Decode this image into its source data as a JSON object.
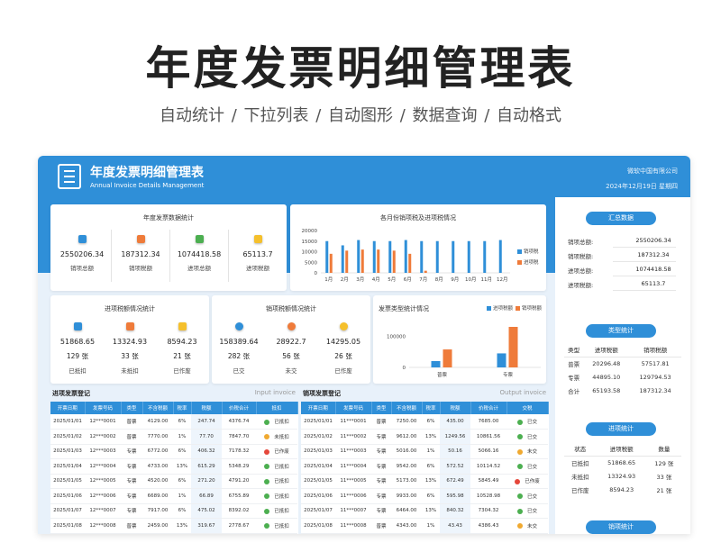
{
  "hero": {
    "title": "年度发票明细管理表",
    "subtitle": "自动统计  /  下拉列表  /  自动图形  /  数据查询  /  自动格式"
  },
  "banner": {
    "title": "年度发票明细管理表",
    "title_en": "Annual Invoice Details Management",
    "company": "微软中国有限公司",
    "date": "2024年12月19日    星期四",
    "icon": "document-checklist-icon"
  },
  "annual_stats": {
    "title": "年度发票数据统计",
    "items": [
      {
        "value": "2550206.34",
        "label": "销项总额",
        "color": "#2f8fd8"
      },
      {
        "value": "187312.34",
        "label": "销项税额",
        "color": "#ef7b3a"
      },
      {
        "value": "1074418.58",
        "label": "进项总额",
        "color": "#4caf50"
      },
      {
        "value": "65113.7",
        "label": "进项税额",
        "color": "#f5c02c"
      }
    ]
  },
  "monthly_chart": {
    "title": "各月份销项税及进项税情况",
    "legend": [
      "销项税",
      "进项税"
    ]
  },
  "chart_data": [
    {
      "type": "bar",
      "title": "各月份销项税及进项税情况",
      "categories": [
        "1月",
        "2月",
        "3月",
        "4月",
        "5月",
        "6月",
        "7月",
        "8月",
        "9月",
        "10月",
        "11月",
        "12月"
      ],
      "series": [
        {
          "name": "销项税",
          "color": "#2f8fd8",
          "values": [
            15000,
            13000,
            15500,
            15000,
            15000,
            15500,
            15000,
            15000,
            15000,
            15000,
            15000,
            15500
          ]
        },
        {
          "name": "进项税",
          "color": "#ef7b3a",
          "values": [
            9000,
            10500,
            11000,
            11000,
            10500,
            9000,
            1000,
            0,
            0,
            0,
            0,
            0
          ]
        }
      ],
      "yticks": [
        "20000",
        "15000",
        "10000",
        "5000",
        "0"
      ],
      "ylim": [
        0,
        20000
      ]
    },
    {
      "type": "bar",
      "title": "发票类型统计情况",
      "categories": [
        "普票",
        "专票"
      ],
      "series": [
        {
          "name": "进项税额",
          "color": "#2f8fd8",
          "values": [
            20296.48,
            44895.1
          ]
        },
        {
          "name": "销项税额",
          "color": "#ef7b3a",
          "values": [
            57517.81,
            129794.53
          ]
        }
      ],
      "yticks": [
        "100000",
        "0"
      ],
      "ylim": [
        0,
        150000
      ]
    }
  ],
  "input_stats": {
    "title": "进项税额情况统计",
    "items": [
      {
        "value": "51868.65",
        "count": "129 张",
        "label": "已抵扣",
        "color": "#2f8fd8"
      },
      {
        "value": "13324.93",
        "count": "33 张",
        "label": "未抵扣",
        "color": "#ef7b3a"
      },
      {
        "value": "8594.23",
        "count": "21 张",
        "label": "已作废",
        "color": "#f5c02c"
      }
    ]
  },
  "output_stats": {
    "title": "销项税额情况统计",
    "items": [
      {
        "value": "158389.64",
        "count": "282 张",
        "label": "已交",
        "color": "#2f8fd8"
      },
      {
        "value": "28922.7",
        "count": "56 张",
        "label": "未交",
        "color": "#ef7b3a"
      },
      {
        "value": "14295.05",
        "count": "26 张",
        "label": "已作废",
        "color": "#f5c02c"
      }
    ]
  },
  "type_chart": {
    "title": "发票类型统计情况",
    "legend": [
      "进项税额",
      "销项税额"
    ]
  },
  "input_table": {
    "title": "进项发票登记",
    "title_en": "Input invoice",
    "headers": [
      "开票日期",
      "发票号码",
      "类型",
      "不含税额",
      "税率",
      "税额",
      "价税合计",
      "抵扣"
    ],
    "rows": [
      {
        "cells": [
          "2025/01/01",
          "12***0001",
          "普票",
          "4129.00",
          "6%",
          "247.74",
          "4376.74",
          "已抵扣"
        ],
        "status": "g"
      },
      {
        "cells": [
          "2025/01/02",
          "12***0002",
          "普票",
          "7770.00",
          "1%",
          "77.70",
          "7847.70",
          "未抵扣"
        ],
        "status": "o"
      },
      {
        "cells": [
          "2025/01/03",
          "12***0003",
          "专票",
          "6772.00",
          "6%",
          "406.32",
          "7178.32",
          "已作废"
        ],
        "status": "r"
      },
      {
        "cells": [
          "2025/01/04",
          "12***0004",
          "专票",
          "4733.00",
          "13%",
          "615.29",
          "5348.29",
          "已抵扣"
        ],
        "status": "g"
      },
      {
        "cells": [
          "2025/01/05",
          "12***0005",
          "专票",
          "4520.00",
          "6%",
          "271.20",
          "4791.20",
          "已抵扣"
        ],
        "status": "g"
      },
      {
        "cells": [
          "2025/01/06",
          "12***0006",
          "专票",
          "6689.00",
          "1%",
          "66.89",
          "6755.89",
          "已抵扣"
        ],
        "status": "g"
      },
      {
        "cells": [
          "2025/01/07",
          "12***0007",
          "专票",
          "7917.00",
          "6%",
          "475.02",
          "8392.02",
          "已抵扣"
        ],
        "status": "g"
      },
      {
        "cells": [
          "2025/01/08",
          "12***0008",
          "普票",
          "2459.00",
          "13%",
          "319.67",
          "2778.67",
          "已抵扣"
        ],
        "status": "g"
      }
    ]
  },
  "output_table": {
    "title": "销项发票登记",
    "title_en": "Output invoice",
    "headers": [
      "开票日期",
      "发票号码",
      "类型",
      "不含税额",
      "税率",
      "税额",
      "价税合计",
      "交税"
    ],
    "rows": [
      {
        "cells": [
          "2025/01/01",
          "11***0001",
          "普票",
          "7250.00",
          "6%",
          "435.00",
          "7685.00",
          "已交"
        ],
        "status": "g"
      },
      {
        "cells": [
          "2025/01/02",
          "11***0002",
          "专票",
          "9612.00",
          "13%",
          "1249.56",
          "10861.56",
          "已交"
        ],
        "status": "g"
      },
      {
        "cells": [
          "2025/01/03",
          "11***0003",
          "专票",
          "5016.00",
          "1%",
          "50.16",
          "5066.16",
          "未交"
        ],
        "status": "o"
      },
      {
        "cells": [
          "2025/01/04",
          "11***0004",
          "专票",
          "9542.00",
          "6%",
          "572.52",
          "10114.52",
          "已交"
        ],
        "status": "g"
      },
      {
        "cells": [
          "2025/01/05",
          "11***0005",
          "专票",
          "5173.00",
          "13%",
          "672.49",
          "5845.49",
          "已作废"
        ],
        "status": "r"
      },
      {
        "cells": [
          "2025/01/06",
          "11***0006",
          "专票",
          "9933.00",
          "6%",
          "595.98",
          "10528.98",
          "已交"
        ],
        "status": "g"
      },
      {
        "cells": [
          "2025/01/07",
          "11***0007",
          "专票",
          "6464.00",
          "13%",
          "840.32",
          "7304.32",
          "已交"
        ],
        "status": "g"
      },
      {
        "cells": [
          "2025/01/08",
          "11***0008",
          "普票",
          "4343.00",
          "1%",
          "43.43",
          "4386.43",
          "未交"
        ],
        "status": "o"
      }
    ]
  },
  "summary": {
    "pill": "汇总数据",
    "items": [
      {
        "k": "销项总额:",
        "v": "2550206.34"
      },
      {
        "k": "销项税额:",
        "v": "187312.34"
      },
      {
        "k": "进项总额:",
        "v": "1074418.58"
      },
      {
        "k": "进项税额:",
        "v": "65113.7"
      }
    ]
  },
  "type_stats": {
    "pill": "类型统计",
    "headers": [
      "类型",
      "进项税额",
      "销项税额"
    ],
    "rows": [
      [
        "普票",
        "20296.48",
        "57517.81"
      ],
      [
        "专票",
        "44895.10",
        "129794.53"
      ],
      [
        "合计",
        "65193.58",
        "187312.34"
      ]
    ]
  },
  "input_tally": {
    "pill": "进项统计",
    "headers": [
      "状态",
      "进项税额",
      "数量"
    ],
    "rows": [
      [
        "已抵扣",
        "51868.65",
        "129 张"
      ],
      [
        "未抵扣",
        "13324.93",
        "33 张"
      ],
      [
        "已作废",
        "8594.23",
        "21 张"
      ]
    ]
  },
  "output_tally": {
    "pill": "销项统计"
  }
}
